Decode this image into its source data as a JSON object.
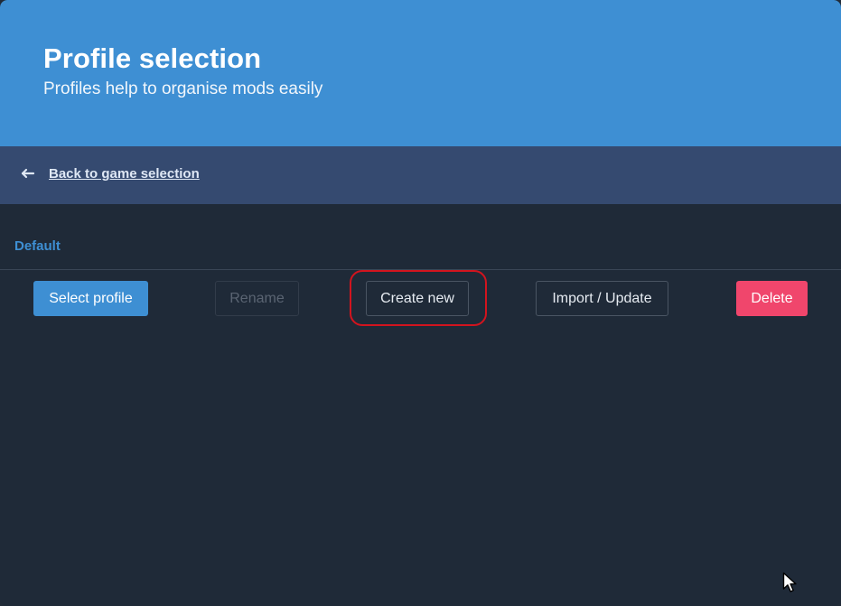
{
  "header": {
    "title": "Profile selection",
    "subtitle": "Profiles help to organise mods easily"
  },
  "breadcrumb": {
    "icon": "arrow-left-icon",
    "back_label": "Back to game selection"
  },
  "profile": {
    "name": "Default"
  },
  "actions": {
    "select_label": "Select profile",
    "rename_label": "Rename",
    "create_label": "Create new",
    "import_label": "Import / Update",
    "delete_label": "Delete"
  },
  "colors": {
    "accent": "#3e8fd3",
    "danger": "#f0466c",
    "background": "#1f2a38",
    "breadcrumb_bg": "#354a70",
    "highlight": "#d2141e"
  }
}
